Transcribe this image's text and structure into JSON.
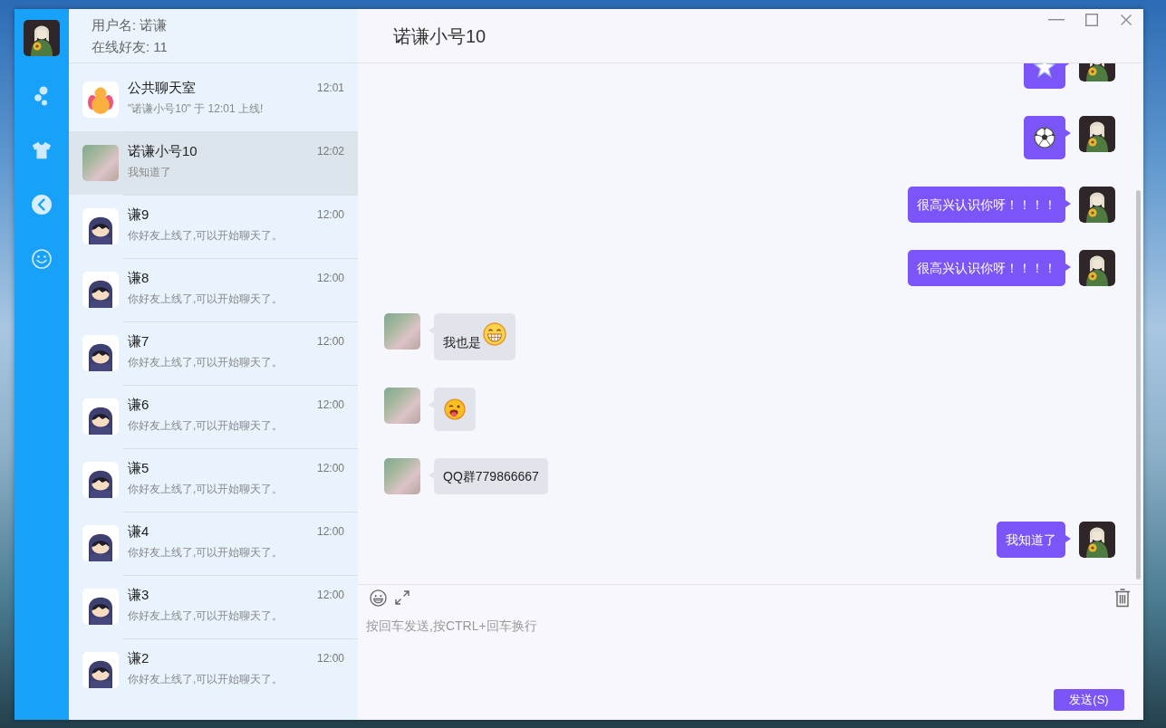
{
  "user_panel": {
    "username": "用户名: 诺谦",
    "online_count": "在线好友: 11"
  },
  "chats": [
    {
      "kind": "group",
      "name": "公共聊天室",
      "time": "12:01",
      "preview": "\"诺谦小号10\" 于 12:01 上线!",
      "selected": false
    },
    {
      "kind": "photo",
      "name": "诺谦小号10",
      "time": "12:02",
      "preview": "我知道了",
      "selected": true
    },
    {
      "kind": "cartoon",
      "name": "谦9",
      "time": "12:00",
      "preview": "你好友上线了,可以开始聊天了。",
      "selected": false
    },
    {
      "kind": "cartoon",
      "name": "谦8",
      "time": "12:00",
      "preview": "你好友上线了,可以开始聊天了。",
      "selected": false
    },
    {
      "kind": "cartoon",
      "name": "谦7",
      "time": "12:00",
      "preview": "你好友上线了,可以开始聊天了。",
      "selected": false
    },
    {
      "kind": "cartoon",
      "name": "谦6",
      "time": "12:00",
      "preview": "你好友上线了,可以开始聊天了。",
      "selected": false
    },
    {
      "kind": "cartoon",
      "name": "谦5",
      "time": "12:00",
      "preview": "你好友上线了,可以开始聊天了。",
      "selected": false
    },
    {
      "kind": "cartoon",
      "name": "谦4",
      "time": "12:00",
      "preview": "你好友上线了,可以开始聊天了。",
      "selected": false
    },
    {
      "kind": "cartoon",
      "name": "谦3",
      "time": "12:00",
      "preview": "你好友上线了,可以开始聊天了。",
      "selected": false
    },
    {
      "kind": "cartoon",
      "name": "谦2",
      "time": "12:00",
      "preview": "你好友上线了,可以开始聊天了。",
      "selected": false
    }
  ],
  "conversation": {
    "title": "诺谦小号10",
    "messages": [
      {
        "outgoing": true,
        "kind": "sticker"
      },
      {
        "outgoing": true,
        "kind": "ball"
      },
      {
        "outgoing": true,
        "kind": "text",
        "text": "很高兴认识你呀！！！！"
      },
      {
        "outgoing": true,
        "kind": "text",
        "text": "很高兴认识你呀！！！！"
      },
      {
        "outgoing": false,
        "kind": "grin",
        "text": "我也是"
      },
      {
        "outgoing": false,
        "kind": "tongue"
      },
      {
        "outgoing": false,
        "kind": "text",
        "text": "QQ群779866667"
      },
      {
        "outgoing": true,
        "kind": "text",
        "text": "我知道了"
      }
    ]
  },
  "composer": {
    "placeholder": "按回车发送,按CTRL+回车换行",
    "send_button": "发送(S)"
  }
}
